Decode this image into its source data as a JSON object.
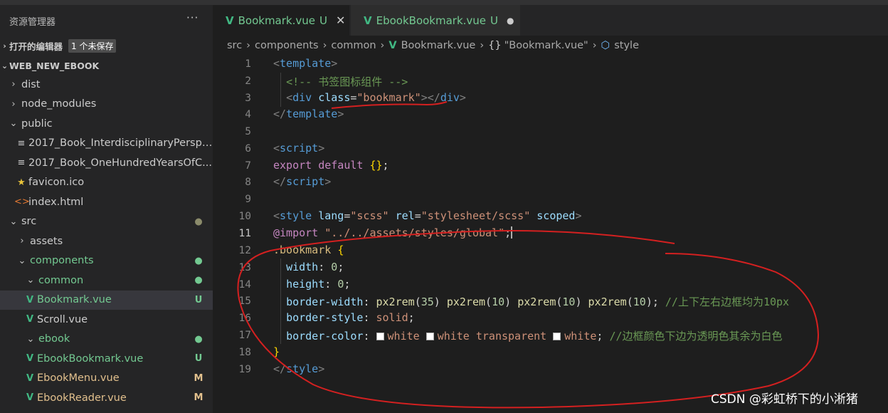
{
  "sidebar": {
    "title": "资源管理器",
    "more": "···",
    "open_editors": {
      "label": "打开的编辑器",
      "badge": "1 个未保存"
    },
    "workspace": "WEB_NEW_EBOOK",
    "tree": [
      {
        "label": "dist",
        "type": "folder",
        "expanded": false,
        "indent": 0
      },
      {
        "label": "node_modules",
        "type": "folder",
        "expanded": false,
        "indent": 0
      },
      {
        "label": "public",
        "type": "folder",
        "expanded": true,
        "indent": 0
      },
      {
        "label": "2017_Book_InterdisciplinaryPerspe...",
        "type": "file",
        "icon": "list-icon",
        "indent": 1
      },
      {
        "label": "2017_Book_OneHundredYearsOfC...",
        "type": "file",
        "icon": "list-icon",
        "indent": 1
      },
      {
        "label": "favicon.ico",
        "type": "file",
        "icon": "star-icon",
        "indent": 1
      },
      {
        "label": "index.html",
        "type": "file",
        "icon": "html-icon",
        "indent": 1
      },
      {
        "label": "src",
        "type": "folder",
        "expanded": true,
        "indent": 0,
        "status": "●"
      },
      {
        "label": "assets",
        "type": "folder",
        "expanded": false,
        "indent": 1
      },
      {
        "label": "components",
        "type": "folder",
        "expanded": true,
        "indent": 1,
        "status": "●"
      },
      {
        "label": "common",
        "type": "folder",
        "expanded": true,
        "indent": 2,
        "status": "●"
      },
      {
        "label": "Bookmark.vue",
        "type": "file",
        "icon": "vue-icon",
        "indent": 2,
        "status": "U",
        "selected": true
      },
      {
        "label": "Scroll.vue",
        "type": "file",
        "icon": "vue-icon",
        "indent": 2
      },
      {
        "label": "ebook",
        "type": "folder",
        "expanded": true,
        "indent": 2,
        "status": "●"
      },
      {
        "label": "EbookBookmark.vue",
        "type": "file",
        "icon": "vue-icon",
        "indent": 2,
        "status": "U"
      },
      {
        "label": "EbookMenu.vue",
        "type": "file",
        "icon": "vue-icon",
        "indent": 2,
        "status": "M"
      },
      {
        "label": "EbookReader.vue",
        "type": "file",
        "icon": "vue-icon",
        "indent": 2,
        "status": "M"
      }
    ]
  },
  "tabs": [
    {
      "label": "Bookmark.vue",
      "status": "U",
      "active": true,
      "close": "✕"
    },
    {
      "label": "EbookBookmark.vue",
      "status": "U",
      "active": false,
      "dirty": "●"
    }
  ],
  "breadcrumb": {
    "parts": [
      "src",
      "components",
      "common"
    ],
    "file": "Bookmark.vue",
    "symbol": "\"Bookmark.vue\"",
    "symbol_icon": "{}",
    "leaf": "style"
  },
  "editor": {
    "current_line": 11,
    "line_numbers": [
      "1",
      "2",
      "3",
      "4",
      "5",
      "6",
      "7",
      "8",
      "9",
      "10",
      "11",
      "12",
      "13",
      "14",
      "15",
      "16",
      "17",
      "18",
      "19"
    ],
    "tokens": {
      "l1_tag": "template",
      "l2_comment": "<!-- 书签图标组件 -->",
      "l3_tag": "div",
      "l3_attr": "class",
      "l3_val": "\"bookmark\"",
      "l3_close": "div",
      "l4_tag": "template",
      "l6_tag": "script",
      "l7_export": "export",
      "l7_default": "default",
      "l7_braces": "{}",
      "l8_tag": "script",
      "l10_tag": "style",
      "l10_a1": "lang",
      "l10_v1": "\"scss\"",
      "l10_a2": "rel",
      "l10_v2": "\"stylesheet/scss\"",
      "l10_a3": "scoped",
      "l11_at": "@import",
      "l11_str": "\"../../assets/styles/global\"",
      "l12_sel": ".bookmark",
      "l13_prop": "width",
      "l13_val": "0",
      "l14_prop": "height",
      "l14_val": "0",
      "l15_prop": "border-width",
      "l15_fn": "px2rem",
      "l15_n1": "35",
      "l15_n2": "10",
      "l15_n3": "10",
      "l15_n4": "10",
      "l15_comment": "//上下左右边框均为10px",
      "l16_prop": "border-style",
      "l16_val": "solid",
      "l17_prop": "border-color",
      "l17_v1": "white",
      "l17_v2": "white",
      "l17_v3": "transparent",
      "l17_v4": "white",
      "l17_comment": "//边框颜色下边为透明色其余为白色",
      "l19_tag": "style"
    }
  },
  "watermark": "CSDN @彩虹桥下的小淅猪",
  "colors": {
    "vue_green": "#41b883",
    "git_untracked": "#73c991",
    "git_modified": "#e2c08d",
    "annotation_red": "#d42020"
  }
}
